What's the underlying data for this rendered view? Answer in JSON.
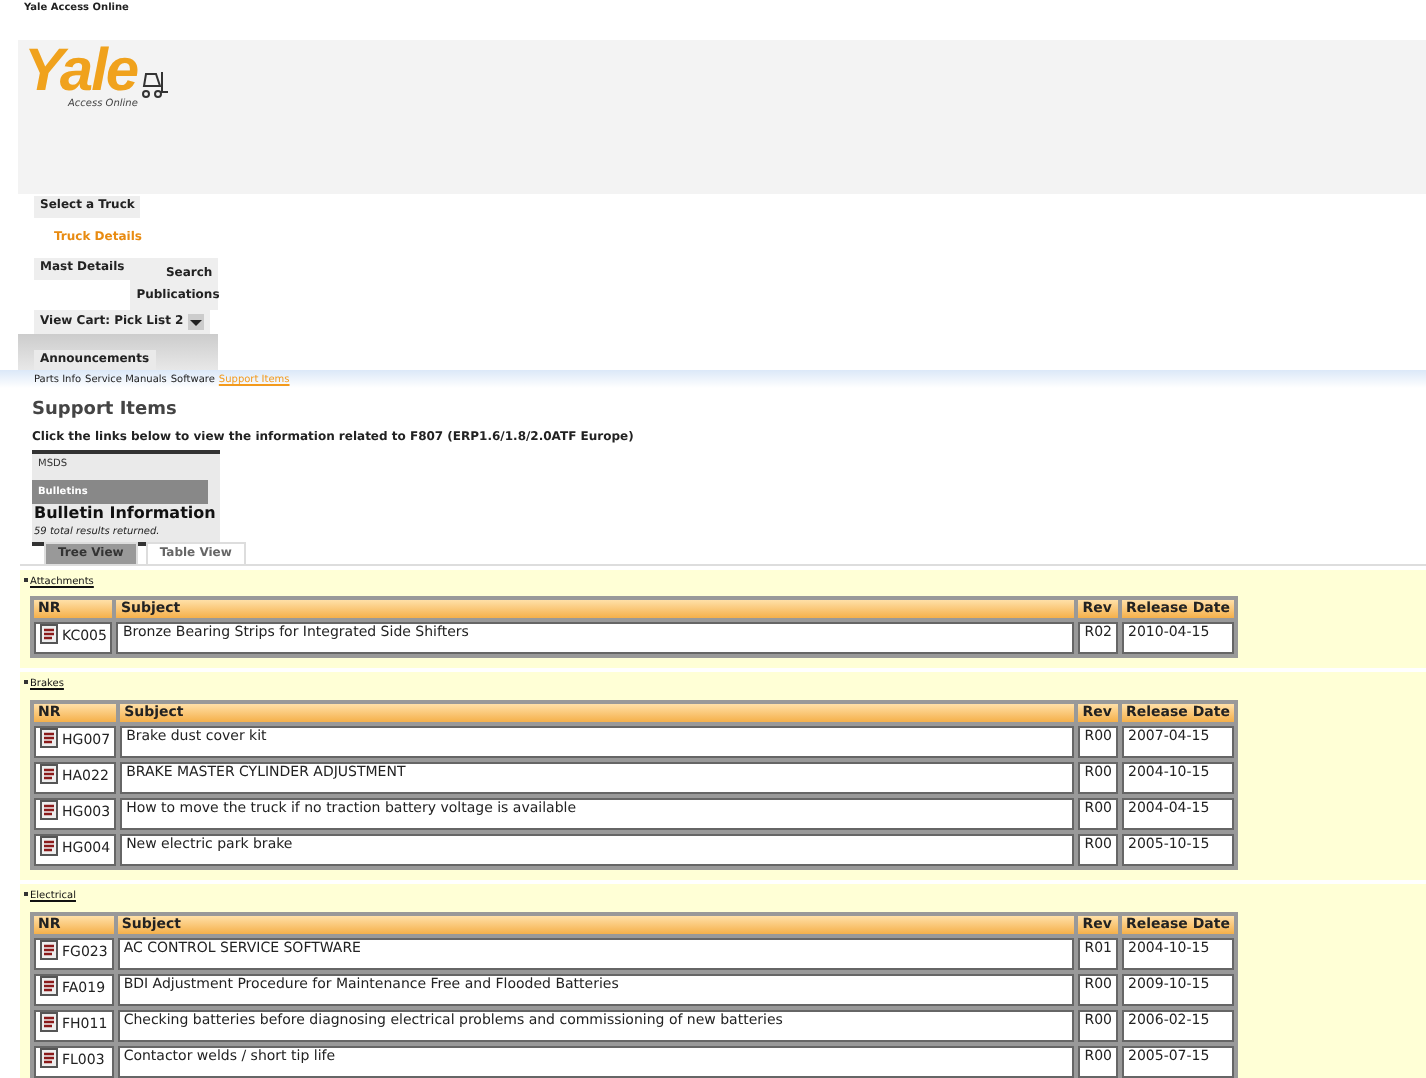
{
  "window": {
    "title": "Yale Access Online"
  },
  "logo": {
    "name": "Yale",
    "tagline": "Access Online"
  },
  "nav": [
    {
      "label": "Select a Truck",
      "selected": false
    },
    {
      "label": "Truck Details",
      "selected": true
    },
    {
      "label": "Mast Details",
      "selected": false
    },
    {
      "label": "Search Publications",
      "selected": false
    }
  ],
  "cart": {
    "label": "View Cart: Pick List 2"
  },
  "announcements_tab": {
    "label": "Announcements"
  },
  "subnav": [
    {
      "label": "Parts Info",
      "selected": false
    },
    {
      "label": "Service Manuals",
      "selected": false
    },
    {
      "label": "Software",
      "selected": false
    },
    {
      "label": "Support Items",
      "selected": true
    }
  ],
  "heading": "Support Items",
  "instruction": "Click the links below to view the information related to F807 (ERP1.6/1.8/2.0ATF Europe)",
  "side_menu": [
    {
      "label": "MSDS",
      "selected": false
    },
    {
      "label": "Bulletins",
      "selected": true
    }
  ],
  "results": {
    "title": "Bulletin Information",
    "summary": "59 total results returned."
  },
  "view_tabs": [
    {
      "label": "Tree View",
      "selected": true
    },
    {
      "label": "Table View",
      "selected": false
    }
  ],
  "sections": [
    {
      "title": "Attachments",
      "columns": [
        "NR",
        "Subject",
        "Rev",
        "Release Date"
      ],
      "rows": [
        [
          "KC005",
          "Bronze Bearing Strips for Integrated Side Shifters",
          "R02",
          "2010-04-15"
        ]
      ]
    },
    {
      "title": "Brakes",
      "columns": [
        "NR",
        "Subject",
        "Rev",
        "Release Date"
      ],
      "rows": [
        [
          "HG007",
          "Brake dust cover kit",
          "R00",
          "2007-04-15"
        ],
        [
          "HA022",
          "BRAKE MASTER CYLINDER ADJUSTMENT",
          "R00",
          "2004-10-15"
        ],
        [
          "HG003",
          "How to move the truck if no traction battery voltage is available",
          "R00",
          "2004-04-15"
        ],
        [
          "HG004",
          "New electric park brake",
          "R00",
          "2005-10-15"
        ]
      ]
    },
    {
      "title": "Electrical",
      "columns": [
        "NR",
        "Subject",
        "Rev",
        "Release Date"
      ],
      "rows": [
        [
          "FG023",
          "AC CONTROL SERVICE SOFTWARE",
          "R01",
          "2004-10-15"
        ],
        [
          "FA019",
          "BDI Adjustment Procedure for Maintenance Free and Flooded Batteries",
          "R00",
          "2009-10-15"
        ],
        [
          "FH011",
          "Checking batteries before diagnosing electrical problems and commissioning of new batteries",
          "R00",
          "2006-02-15"
        ],
        [
          "FL003",
          "Contactor welds / short tip life",
          "R00",
          "2005-07-15"
        ]
      ]
    }
  ]
}
